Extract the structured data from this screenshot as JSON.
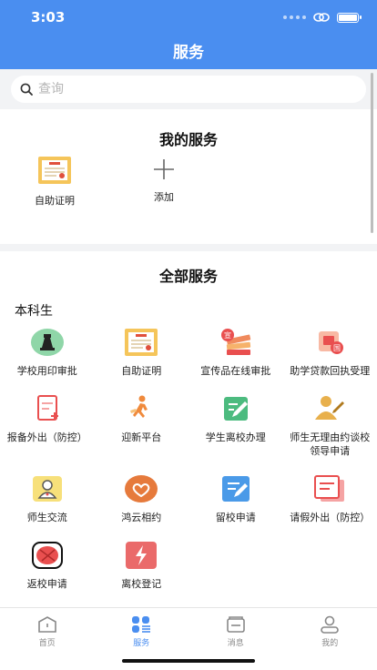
{
  "status_bar": {
    "time": "3:03"
  },
  "header": {
    "title": "服务"
  },
  "search": {
    "placeholder": "查询"
  },
  "my_services": {
    "title": "我的服务",
    "items": [
      {
        "label": "自助证明",
        "icon": "certificate-icon"
      },
      {
        "label": "添加",
        "icon": "plus-icon"
      }
    ]
  },
  "all_services": {
    "title": "全部服务",
    "group": "本科生",
    "items": [
      {
        "label": "学校用印审批",
        "icon": "seal-icon"
      },
      {
        "label": "自助证明",
        "icon": "certificate-icon"
      },
      {
        "label": "宣传品在线审批",
        "icon": "publicity-icon"
      },
      {
        "label": "助学贷款回执受理",
        "icon": "loan-icon"
      },
      {
        "label": "报备外出（防控）",
        "icon": "report-icon"
      },
      {
        "label": "迎新平台",
        "icon": "welcome-icon"
      },
      {
        "label": "学生离校办理",
        "icon": "leave-school-icon"
      },
      {
        "label": "师生无理由约谈校领导申请",
        "icon": "meeting-icon"
      },
      {
        "label": "师生交流",
        "icon": "communication-icon"
      },
      {
        "label": "鸿云相约",
        "icon": "heart-cloud-icon"
      },
      {
        "label": "留校申请",
        "icon": "stay-icon"
      },
      {
        "label": "请假外出（防控）",
        "icon": "leave-request-icon"
      },
      {
        "label": "返校申请",
        "icon": "return-icon"
      },
      {
        "label": "离校登记",
        "icon": "register-icon"
      }
    ]
  },
  "tabbar": {
    "items": [
      {
        "label": "首页",
        "icon": "home-icon",
        "active": false
      },
      {
        "label": "服务",
        "icon": "services-icon",
        "active": true
      },
      {
        "label": "消息",
        "icon": "message-icon",
        "active": false
      },
      {
        "label": "我的",
        "icon": "profile-icon",
        "active": false
      }
    ]
  },
  "colors": {
    "primary": "#4a8ef0",
    "background": "#f2f3f5",
    "active_tab": "#4a8ef0",
    "inactive_tab": "#888888"
  }
}
